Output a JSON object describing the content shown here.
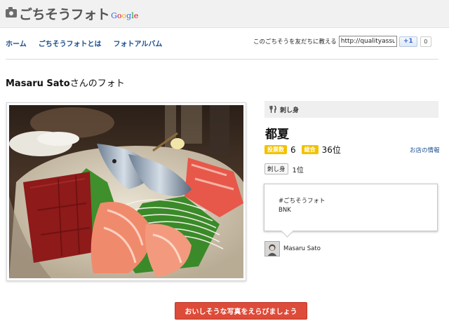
{
  "header": {
    "logo_text": "ごちそうフォト",
    "google_mark": "Google"
  },
  "nav": {
    "items": [
      {
        "label": "ホーム"
      },
      {
        "label": "ごちそうフォトとは"
      },
      {
        "label": "フォトアルバム"
      }
    ]
  },
  "share": {
    "label": "このごちそうを友だちに教える",
    "url_value": "http://qualityassuran",
    "plusone_label": "+1",
    "plusone_count": "0"
  },
  "page": {
    "user_name": "Masaru Sato",
    "title_suffix": "さんのフォト"
  },
  "photo": {
    "subject": "sashimi-platter"
  },
  "sidebar": {
    "category_icon": "fork-knife-icon",
    "category_label": "刺し身",
    "shop_name": "都夏",
    "posts_badge": "投票数",
    "posts_value": "6",
    "overall_badge": "総合",
    "overall_value": "36位",
    "shop_info_link": "お店の情報",
    "tag_label": "刺し身",
    "tag_rank": "1位",
    "comment_lines": [
      "#ごちそうフォト",
      "BNK"
    ],
    "author_name": "Masaru Sato"
  },
  "cta": {
    "label": "おいしそうな写真をえらびましょう"
  },
  "colors": {
    "link": "#1a4d90",
    "badge": "#f2c200",
    "cta": "#dd4b39",
    "topbar": "#f1f1f1"
  }
}
